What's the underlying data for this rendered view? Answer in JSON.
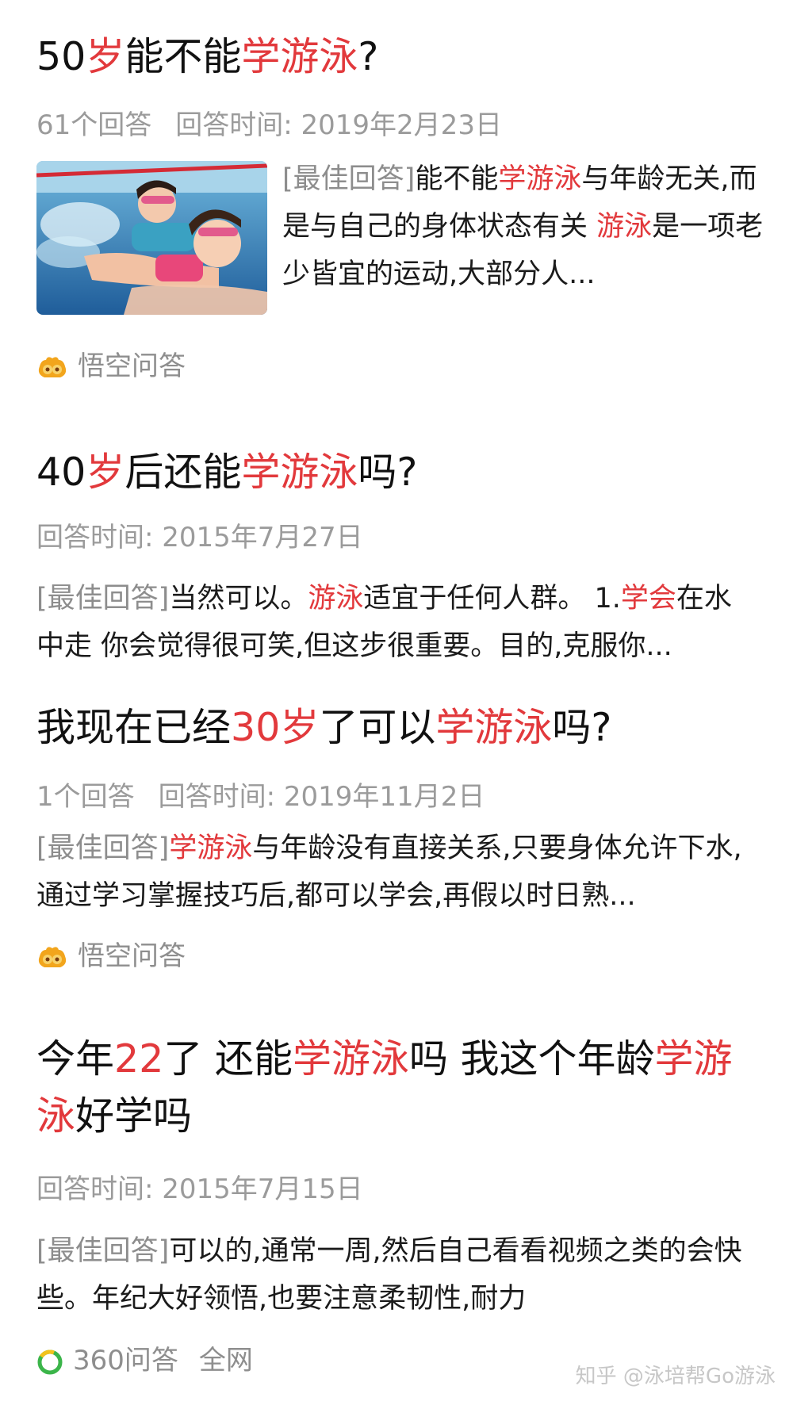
{
  "items": [
    {
      "title": [
        {
          "t": "50"
        },
        {
          "t": "岁",
          "hl": true
        },
        {
          "t": "能不能"
        },
        {
          "t": "学游泳",
          "hl": true
        },
        {
          "t": "?"
        }
      ],
      "meta": [
        "61个回答",
        "回答时间: 2019年2月23日"
      ],
      "answer": [
        {
          "t": "[最佳回答]",
          "tag": true
        },
        {
          "t": "能不能"
        },
        {
          "t": "学游泳",
          "hl": true
        },
        {
          "t": "与年龄无关,而是与自己的身体状态有关 "
        },
        {
          "t": "游泳",
          "hl": true
        },
        {
          "t": "是一项老少皆宜的运动,大部分人..."
        }
      ],
      "source": "悟空问答"
    },
    {
      "title": [
        {
          "t": "40"
        },
        {
          "t": "岁",
          "hl": true
        },
        {
          "t": "后还能"
        },
        {
          "t": "学游泳",
          "hl": true
        },
        {
          "t": "吗?"
        }
      ],
      "meta": [
        "回答时间: 2015年7月27日"
      ],
      "answer": [
        {
          "t": "[最佳回答]",
          "tag": true
        },
        {
          "t": "当然可以。"
        },
        {
          "t": "游泳",
          "hl": true
        },
        {
          "t": "适宜于任何人群。 1."
        },
        {
          "t": "学会",
          "hl": true
        },
        {
          "t": "在水中走 你会觉得很可笑,但这步很重要。目的,克服你..."
        }
      ]
    },
    {
      "title": [
        {
          "t": "我现在已经"
        },
        {
          "t": "30岁",
          "hl": true
        },
        {
          "t": "了可以"
        },
        {
          "t": "学游泳",
          "hl": true
        },
        {
          "t": "吗?"
        }
      ],
      "meta": [
        "1个回答",
        "回答时间: 2019年11月2日"
      ],
      "answer": [
        {
          "t": "[最佳回答]",
          "tag": true
        },
        {
          "t": "学游泳",
          "hl": true
        },
        {
          "t": "与年龄没有直接关系,只要身体允许下水,通过学习掌握技巧后,都可以学会,再假以时日熟..."
        }
      ],
      "source": "悟空问答"
    },
    {
      "title": [
        {
          "t": "今年"
        },
        {
          "t": "22",
          "hl": true
        },
        {
          "t": "了 还能"
        },
        {
          "t": "学游泳",
          "hl": true
        },
        {
          "t": "吗 我这个年龄"
        },
        {
          "t": "学游泳",
          "hl": true
        },
        {
          "t": "好学吗"
        }
      ],
      "meta": [
        "回答时间: 2015年7月15日"
      ],
      "answer": [
        {
          "t": "[最佳回答]",
          "tag": true
        },
        {
          "t": "可以的,通常一周,然后自己看看视频之类的会快些。年纪大好领悟,也要注意柔韧性,耐力"
        }
      ],
      "source": "360问答",
      "source_extra": "全网"
    }
  ],
  "watermark": "知乎 @泳培帮Go游泳",
  "colors": {
    "highlight": "#e2393c",
    "meta": "#9b9b9b",
    "text": "#1b1b1b"
  }
}
